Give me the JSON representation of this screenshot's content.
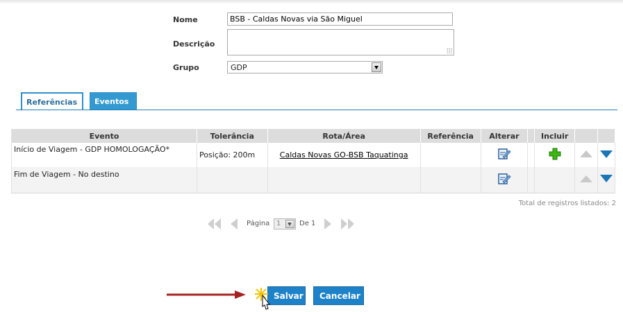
{
  "form": {
    "nome_label": "Nome",
    "nome_value": "BSB - Caldas Novas via São Miguel",
    "descricao_label": "Descrição",
    "descricao_value": "",
    "grupo_label": "Grupo",
    "grupo_value": "GDP"
  },
  "tabs": [
    {
      "label": "Referências",
      "active": false
    },
    {
      "label": "Eventos",
      "active": true
    }
  ],
  "table": {
    "headers": [
      "Evento",
      "Tolerância",
      "Rota/Área",
      "Referência",
      "Alterar",
      "Incluir"
    ],
    "rows": [
      {
        "evento": "Início de Viagem - GDP HOMOLOGAÇÃO*",
        "tolerancia": "Posição: 200m",
        "rota": "Caldas Novas GO-BSB Taquatinga",
        "referencia": ""
      },
      {
        "evento": "Fim de Viagem - No destino",
        "tolerancia": "",
        "rota": "",
        "referencia": ""
      }
    ]
  },
  "total_text": "Total de registros listados: 2",
  "pager": {
    "pagina_label": "Página",
    "page_value": "1",
    "de_label": "De 1"
  },
  "buttons": {
    "save_label": "Salvar",
    "cancel_label": "Cancelar"
  },
  "icons": {
    "edit": "edit-icon",
    "add": "add-plus-icon",
    "move_up": "move-up-icon",
    "move_down": "move-down-icon",
    "first": "first-page-icon",
    "prev": "prev-page-icon",
    "next": "next-page-icon",
    "last": "last-page-icon",
    "pointer": "hand-cursor-icon",
    "arrow": "red-arrow-icon"
  },
  "colors": {
    "accent": "#1e82c8",
    "plus": "#3cb515",
    "arrow": "#a52020"
  }
}
